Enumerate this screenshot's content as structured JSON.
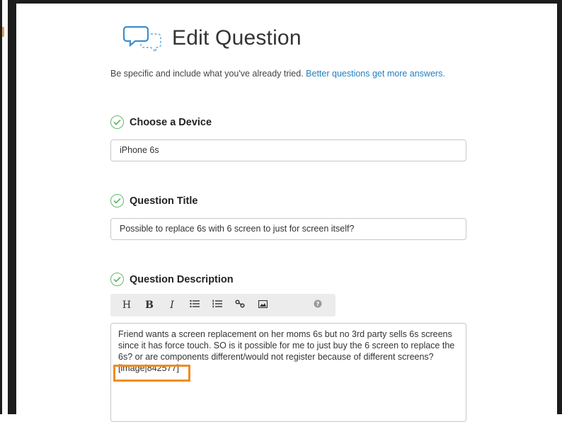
{
  "page": {
    "title": "Edit Question",
    "intro_text": "Be specific and include what you've already tried.",
    "intro_link": "Better questions get more answers."
  },
  "sections": {
    "device": {
      "label": "Choose a Device",
      "value": "iPhone 6s"
    },
    "title": {
      "label": "Question Title",
      "value": "Possible to replace 6s with 6 screen to just for screen itself?"
    },
    "description": {
      "label": "Question Description",
      "value": "Friend wants a screen replacement on her moms 6s but no 3rd party sells 6s screens since it has force touch. SO is it possible for me to just buy the 6 screen to replace the 6s? or are components different/would not register because of different screens?\n[image|842577]"
    }
  },
  "toolbar": {
    "heading": "H",
    "bold": "B",
    "italic": "I",
    "bullet_list_icon": "≔",
    "numbered_list_icon": "☰",
    "link_icon": "%",
    "image_icon": "▣",
    "help_icon": "?"
  },
  "colors": {
    "accent": "#1f7fc1",
    "check": "#63b96b",
    "highlight": "#f08c1f"
  }
}
